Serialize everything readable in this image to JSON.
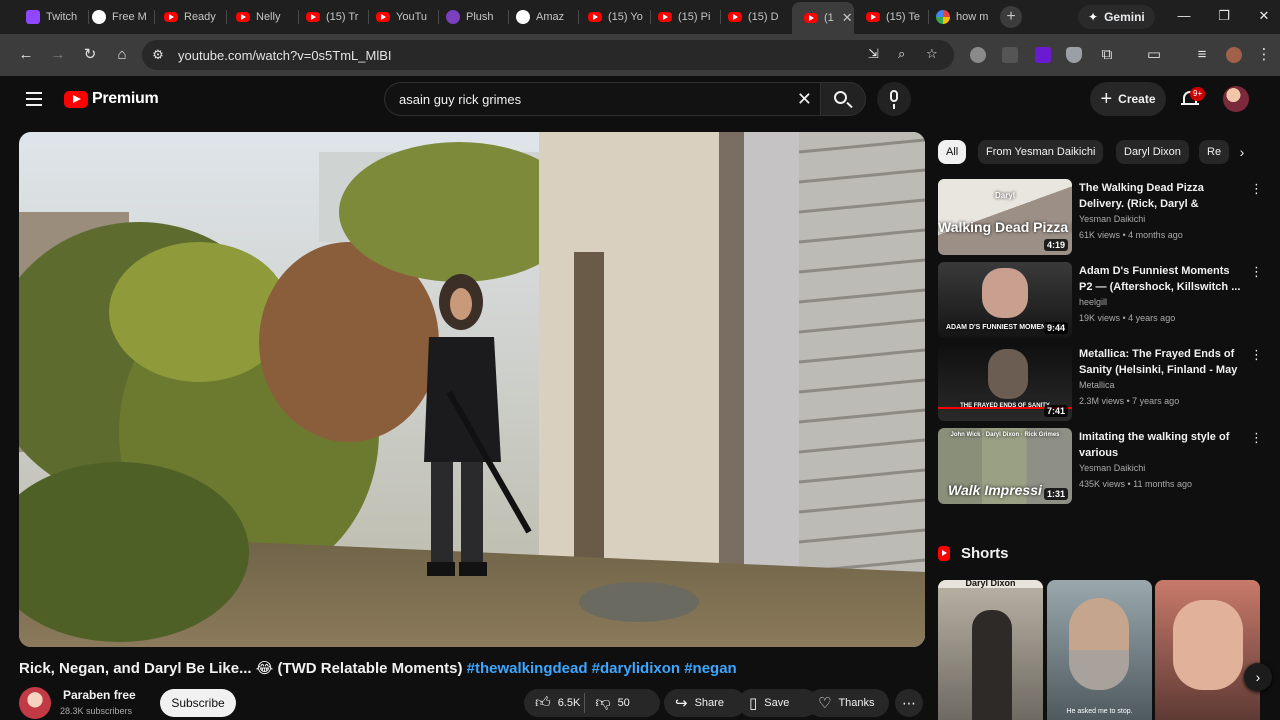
{
  "browser": {
    "tabs": [
      {
        "label": "Twitch",
        "fav": "twitch"
      },
      {
        "label": "Free M",
        "fav": "round"
      },
      {
        "label": "Ready",
        "fav": "yt"
      },
      {
        "label": "Nelly",
        "fav": "yt"
      },
      {
        "label": "(15) Tr",
        "fav": "yt"
      },
      {
        "label": "YouTu",
        "fav": "yt"
      },
      {
        "label": "Plush",
        "fav": "plush"
      },
      {
        "label": "Amaz",
        "fav": "amz"
      },
      {
        "label": "(15) Yo",
        "fav": "yt"
      },
      {
        "label": "(15) Pi",
        "fav": "yt"
      },
      {
        "label": "(15) D",
        "fav": "yt"
      },
      {
        "label": "(1",
        "fav": "yt"
      },
      {
        "label": "(15) Te",
        "fav": "yt"
      },
      {
        "label": "how m",
        "fav": "google"
      }
    ],
    "gemini_label": "Gemini",
    "url": "youtube.com/watch?v=0s5TmL_MlBI"
  },
  "header": {
    "logo_text": "Premium",
    "search_value": "asain guy rick grimes",
    "create_label": "Create",
    "notification_count": "9+"
  },
  "video": {
    "title": "Rick, Negan, and Daryl Be Like... 😂 (TWD Relatable Moments)",
    "hashtags": [
      "#thewalkingdead",
      "#darylidixon",
      "#negan"
    ],
    "channel_name": "Paraben free",
    "subscribers": "28.3K subscribers",
    "subscribe_label": "Subscribe",
    "likes": "6.5K",
    "dislikes": "50",
    "share_label": "Share",
    "save_label": "Save",
    "thanks_label": "Thanks"
  },
  "sidebar": {
    "chips": [
      "All",
      "From Yesman Daikichi",
      "Daryl Dixon",
      "Re"
    ],
    "recommendations": [
      {
        "title": "The Walking Dead Pizza Delivery. (Rick, Daryl & Negan)...",
        "channel": "Yesman Daikichi",
        "meta": "61K views • 4 months ago",
        "duration": "4:19",
        "thumb_text": "Walking Dead Pizza Delivery",
        "thumb_tag": "Daryl"
      },
      {
        "title": "Adam D's Funniest Moments P2 — (Aftershock, Killswitch ...",
        "channel": "heelgill",
        "meta": "19K views • 4 years ago",
        "duration": "9:44",
        "thumb_text": "ADAM D'S FUNNIEST MOMENTS P"
      },
      {
        "title": "Metallica: The Frayed Ends of Sanity (Helsinki, Finland - May ...",
        "channel": "Metallica",
        "meta": "2.3M views • 7 years ago",
        "duration": "7:41",
        "thumb_text": "THE FRAYED ENDS OF SANITY"
      },
      {
        "title": "Imitating the walking style of various characters.#darylidixo...",
        "channel": "Yesman Daikichi",
        "meta": "435K views • 11 months ago",
        "duration": "1:31",
        "thumb_text": "Walk Impressi",
        "thumb_tags": [
          "John Wick",
          "Daryl Dixon",
          "Rick Grimes"
        ]
      }
    ],
    "shorts_label": "Shorts",
    "shorts": [
      {
        "caption_top": "Daryl Dixon",
        "caption": ""
      },
      {
        "caption_top": "",
        "caption": "He asked me to stop."
      },
      {
        "caption_top": "",
        "caption": ""
      }
    ]
  },
  "colors": {
    "background": "#0f0f0f",
    "accent_red": "#ff0000",
    "hashtag_blue": "#3ea6ff"
  }
}
